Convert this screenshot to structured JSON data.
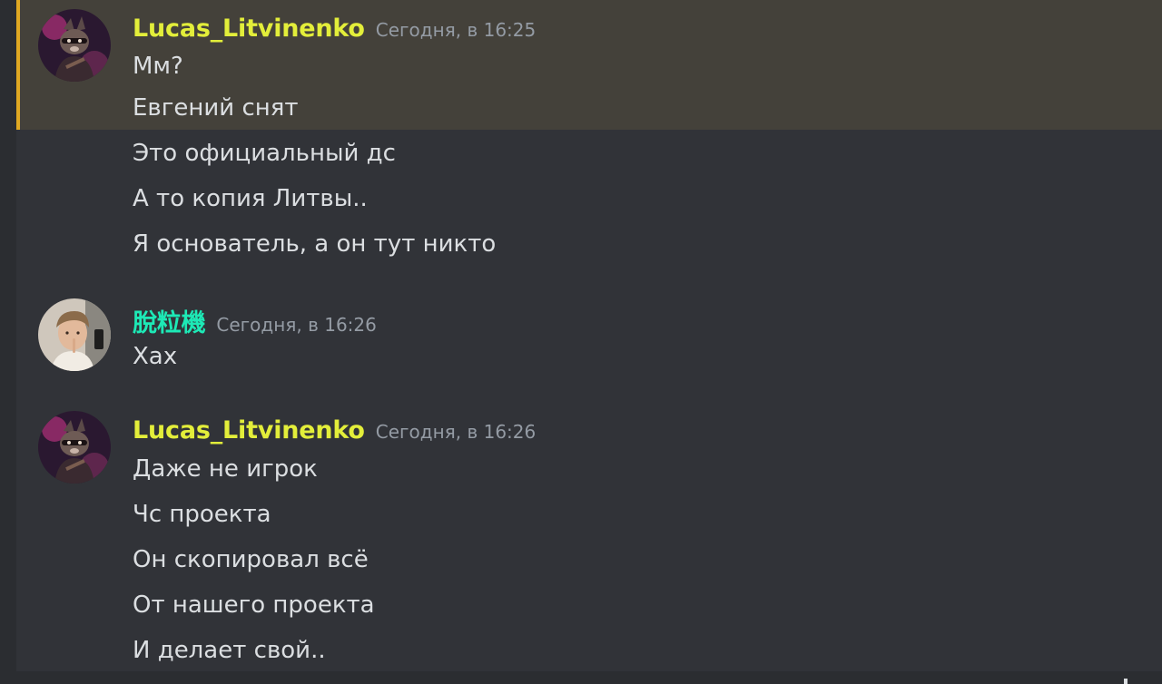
{
  "messages": [
    {
      "username": "Lucas_Litvinenko",
      "username_color": "#e3ee3a",
      "timestamp": "Сегодня, в 16:25",
      "avatar": "raccoon-avatar-icon",
      "highlighted": true,
      "highlight_color": "#44413a",
      "highlight_bar_color": "#e0a822",
      "lines": [
        "Мм?",
        "Евгений снят",
        "Это официальный дс",
        "А то копия Литвы..",
        "Я основатель, а он тут никто"
      ]
    },
    {
      "username": "脫粒機",
      "username_color": "#1de9b6",
      "timestamp": "Сегодня, в 16:26",
      "avatar": "person-avatar-icon",
      "highlighted": false,
      "lines": [
        "Хах"
      ]
    },
    {
      "username": "Lucas_Litvinenko",
      "username_color": "#e3ee3a",
      "timestamp": "Сегодня, в 16:26",
      "avatar": "raccoon-avatar-icon",
      "highlighted": false,
      "lines": [
        "Даже не игрок",
        "Чс проекта",
        "Он скопировал всё",
        "От нашего проекта",
        "И делает свой.."
      ]
    }
  ]
}
